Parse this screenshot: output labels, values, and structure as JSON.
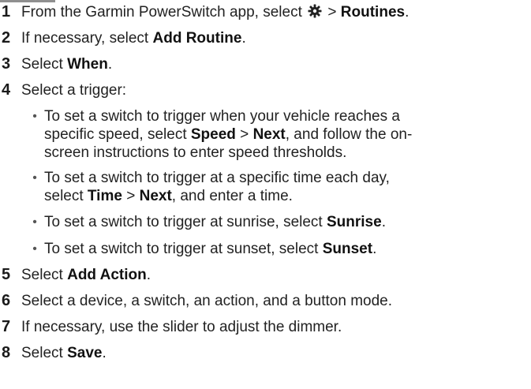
{
  "steps": [
    {
      "num": "1",
      "pre": "From the Garmin PowerSwitch app, select ",
      "icon": "gear-icon",
      "mid": " > ",
      "bold": "Routines",
      "post": "."
    },
    {
      "num": "2",
      "pre": "If necessary, select ",
      "bold": "Add Routine",
      "post": "."
    },
    {
      "num": "3",
      "pre": "Select ",
      "bold": "When",
      "post": "."
    },
    {
      "num": "4",
      "text": "Select a trigger:"
    },
    {
      "num": "5",
      "pre": "Select ",
      "bold": "Add Action",
      "post": "."
    },
    {
      "num": "6",
      "text": "Select a device, a switch, an action, and a button mode."
    },
    {
      "num": "7",
      "text": "If necessary, use the slider to adjust the dimmer."
    },
    {
      "num": "8",
      "pre": "Select ",
      "bold": "Save",
      "post": "."
    }
  ],
  "bullet_char": "•",
  "bullets": [
    {
      "line1": "To set a switch to trigger when your vehicle reaches a",
      "line2_pre": "specific speed, select ",
      "line2_bold1": "Speed",
      "line2_mid": " > ",
      "line2_bold2": "Next",
      "line2_post": ", and follow the on-",
      "line3": "screen instructions to enter speed thresholds."
    },
    {
      "line1": "To set a switch to trigger at a specific time each day,",
      "line2_pre": "select ",
      "line2_bold1": "Time",
      "line2_mid": " > ",
      "line2_bold2": "Next",
      "line2_post": ", and enter a time."
    },
    {
      "pre": "To set a switch to trigger at sunrise, select ",
      "bold": "Sunrise",
      "post": "."
    },
    {
      "pre": "To set a switch to trigger at sunset, select ",
      "bold": "Sunset",
      "post": "."
    }
  ]
}
